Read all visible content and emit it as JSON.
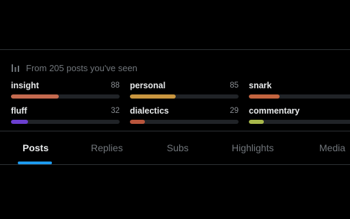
{
  "stats": {
    "header_text": "From 205 posts you've seen",
    "header_icon": "bar-chart-icon",
    "metrics": [
      {
        "label": "insight",
        "value": "88",
        "fill_fraction": 0.44,
        "color": "#c46a4f"
      },
      {
        "label": "personal",
        "value": "85",
        "fill_fraction": 0.42,
        "color": "#c9963f"
      },
      {
        "label": "snark",
        "value": "",
        "fill_fraction": 0.28,
        "color": "#c3643f"
      },
      {
        "label": "fluff",
        "value": "32",
        "fill_fraction": 0.16,
        "color": "#6b3fcf"
      },
      {
        "label": "dialectics",
        "value": "29",
        "fill_fraction": 0.14,
        "color": "#b9553c"
      },
      {
        "label": "commentary",
        "value": "",
        "fill_fraction": 0.14,
        "color": "#a8b84a"
      }
    ]
  },
  "tabs": {
    "items": [
      {
        "label": "Posts",
        "active": true
      },
      {
        "label": "Replies",
        "active": false
      },
      {
        "label": "Subs",
        "active": false
      },
      {
        "label": "Highlights",
        "active": false
      },
      {
        "label": "Media",
        "active": false
      }
    ],
    "accent_color": "#1d9bf0"
  }
}
